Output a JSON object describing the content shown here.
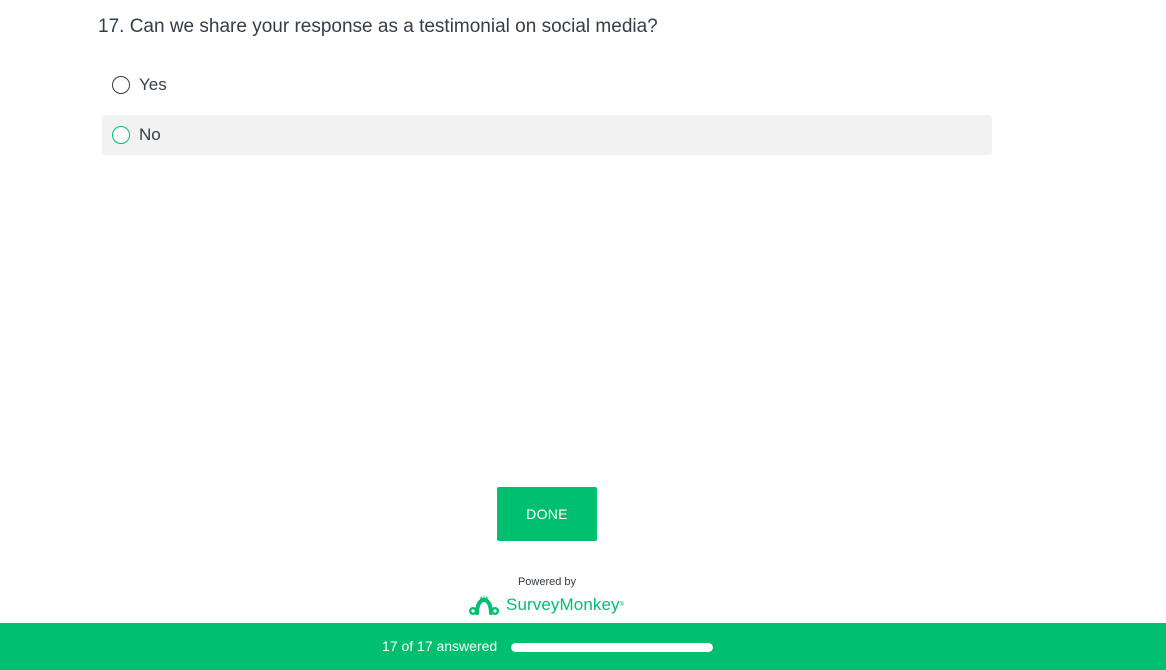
{
  "question": {
    "title": "17. Can we share your response as a testimonial on social media?",
    "choices": [
      {
        "label": "Yes",
        "selected": false
      },
      {
        "label": "No",
        "selected": false
      }
    ]
  },
  "actions": {
    "done_label": "DONE"
  },
  "branding": {
    "powered_by": "Powered by",
    "name": "SurveyMonkey",
    "trademark": "®",
    "logo_icon": "surveymonkey-logo-icon"
  },
  "progress": {
    "text": "17 of 17 answered",
    "answered": 17,
    "total": 17,
    "fraction": 1.0
  },
  "colors": {
    "accent": "#00bf6f",
    "text": "#333e48",
    "hover_bg": "#f2f2f2"
  }
}
